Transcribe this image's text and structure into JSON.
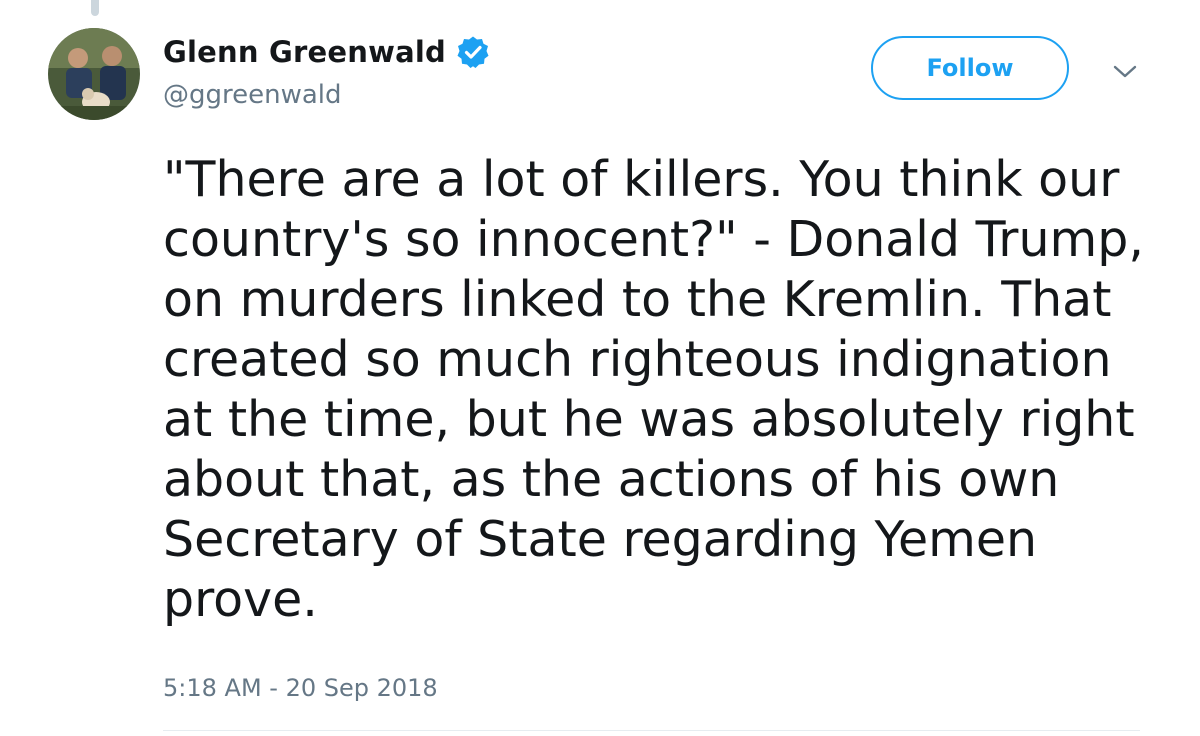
{
  "tweet": {
    "author": {
      "display_name": "Glenn Greenwald",
      "handle": "@ggreenwald",
      "verified": true
    },
    "follow_label": "Follow",
    "text": "\"There are a lot of killers. You think our country's so innocent?\" - Donald Trump, on murders linked to the Kremlin. That created so much righteous indignation at the time, but he was absolutely right about that, as the actions of his own Secretary of State regarding Yemen prove.",
    "timestamp": "5:18 AM - 20 Sep 2018"
  },
  "icons": {
    "verified": "verified-badge-icon",
    "caret": "chevron-down-icon"
  },
  "colors": {
    "accent": "#1da1f2",
    "text": "#14171a",
    "muted": "#657786",
    "divider": "#e6ecf0"
  }
}
